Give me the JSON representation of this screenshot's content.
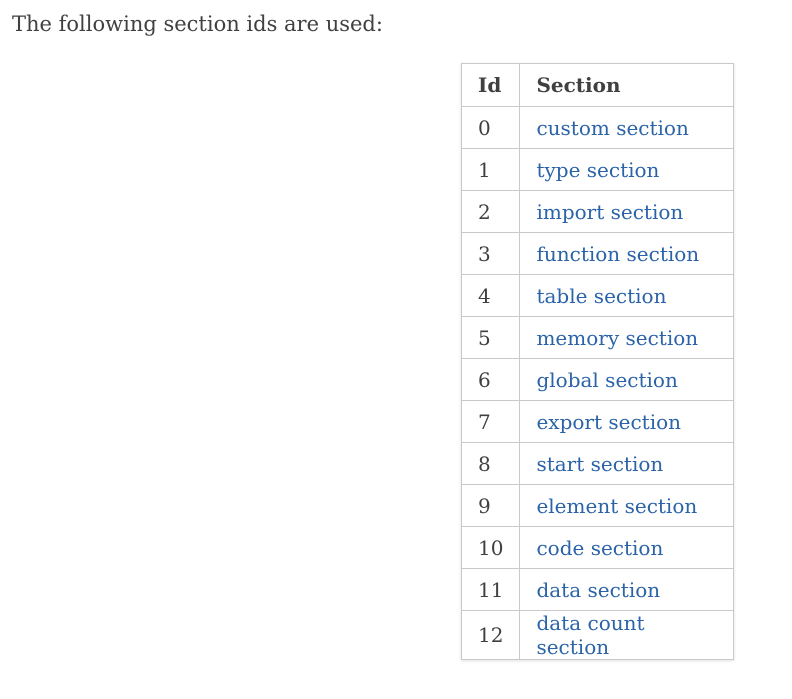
{
  "intro": "The following section ids are used:",
  "table": {
    "headers": {
      "id": "Id",
      "section": "Section"
    },
    "rows": [
      {
        "id": "0",
        "section": "custom section"
      },
      {
        "id": "1",
        "section": "type section"
      },
      {
        "id": "2",
        "section": "import section"
      },
      {
        "id": "3",
        "section": "function section"
      },
      {
        "id": "4",
        "section": "table section"
      },
      {
        "id": "5",
        "section": "memory section"
      },
      {
        "id": "6",
        "section": "global section"
      },
      {
        "id": "7",
        "section": "export section"
      },
      {
        "id": "8",
        "section": "start section"
      },
      {
        "id": "9",
        "section": "element section"
      },
      {
        "id": "10",
        "section": "code section"
      },
      {
        "id": "11",
        "section": "data section"
      },
      {
        "id": "12",
        "section": "data count section"
      }
    ]
  },
  "colors": {
    "text": "#404040",
    "link": "#2a63a8",
    "border": "#c9c9c9"
  }
}
